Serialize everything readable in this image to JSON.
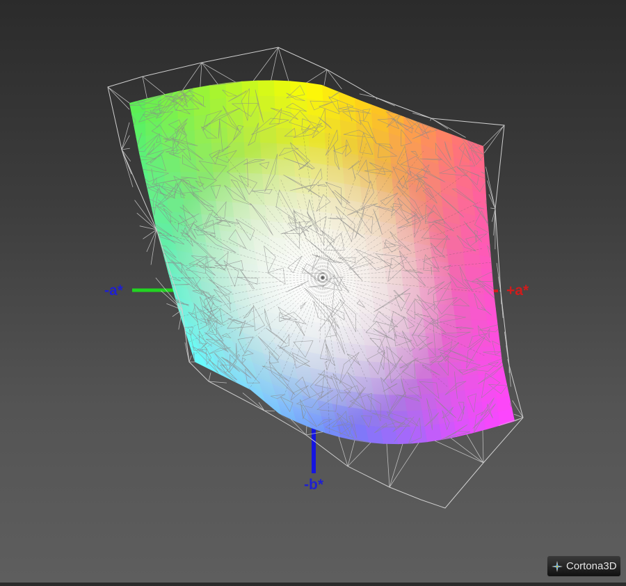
{
  "axes": {
    "neg_a": {
      "label": "-a*",
      "color": "#1f1fd0",
      "line_color": "#22d422"
    },
    "pos_a": {
      "label": "+a*",
      "color": "#d01c1c",
      "line_color": "#d01c1c"
    },
    "neg_b": {
      "label": "-b*",
      "color": "#1f1fd0",
      "line_color": "#1515e0"
    }
  },
  "gamut_colors": {
    "yellow": "#ffff00",
    "green": "#55ee55",
    "cyan": "#55ffff",
    "blue": "#7777ff",
    "magenta": "#ff44ff",
    "orange": "#ff7744",
    "white": "#ffffff",
    "wireframe": "#cfcfcf"
  },
  "viewer": {
    "brand": "Cortona3D",
    "brand_icon": "cortona-star-icon"
  }
}
